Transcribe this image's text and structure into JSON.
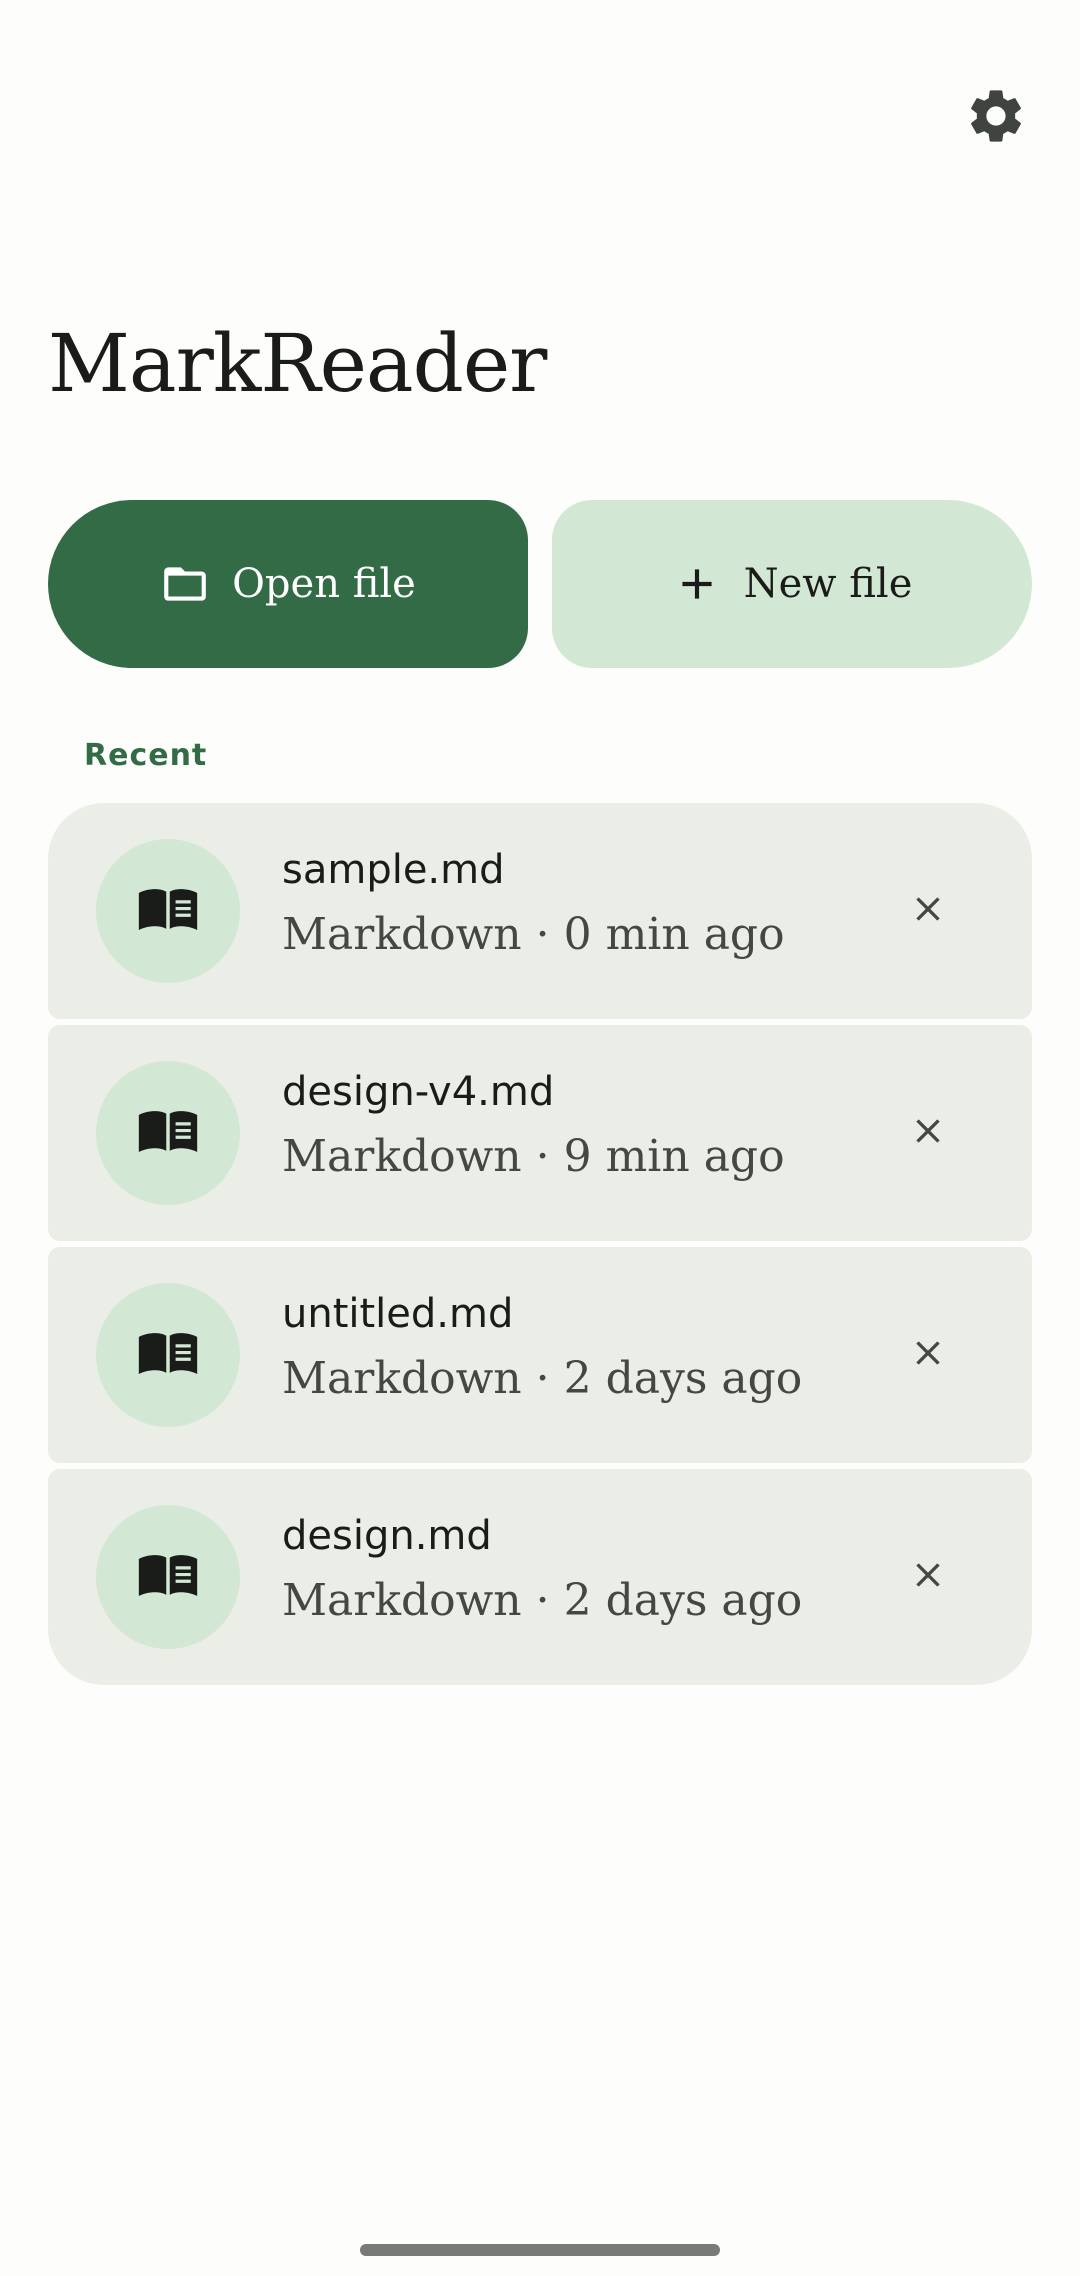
{
  "app": {
    "title": "MarkReader"
  },
  "header": {
    "settings_icon": "gear-icon"
  },
  "actions": {
    "open_label": "Open file",
    "open_icon": "folder-icon",
    "new_label": "New file",
    "new_icon": "plus-icon"
  },
  "recent": {
    "label": "Recent",
    "items": [
      {
        "name": "sample.md",
        "meta": "Markdown · 0 min ago"
      },
      {
        "name": "design-v4.md",
        "meta": "Markdown · 9 min ago"
      },
      {
        "name": "untitled.md",
        "meta": "Markdown · 2 days ago"
      },
      {
        "name": "design.md",
        "meta": "Markdown · 2 days ago"
      }
    ],
    "item_icon": "book-icon",
    "remove_icon": "close-icon"
  },
  "colors": {
    "primary": "#326b45",
    "primary_container": "#d2e8d4",
    "surface_variant": "#ebede7",
    "background": "#fdfdfb"
  }
}
